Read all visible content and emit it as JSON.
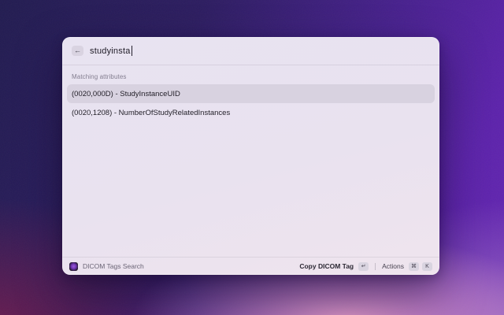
{
  "window": {
    "search": {
      "back_icon": "←",
      "value": "studyinsta",
      "placeholder": ""
    },
    "section_header": "Matching attributes",
    "results": [
      {
        "label": "(0020,000D) - StudyInstanceUID",
        "selected": true
      },
      {
        "label": "(0020,1208) - NumberOfStudyRelatedInstances",
        "selected": false
      }
    ],
    "footer": {
      "app_name": "DICOM Tags Search",
      "primary_action": "Copy DICOM Tag",
      "primary_action_key": "↵",
      "actions_label": "Actions",
      "actions_keys": [
        "⌘",
        "K"
      ]
    }
  },
  "colors": {
    "selected_row": "#d8d2e0",
    "window_background": "#e9e2ef",
    "keycap_background": "#d9d4e0",
    "background_purple": "#5c22ab",
    "background_navy": "#211b50",
    "background_pink": "#e29cc6",
    "background_maroon": "#6e1b4e"
  }
}
